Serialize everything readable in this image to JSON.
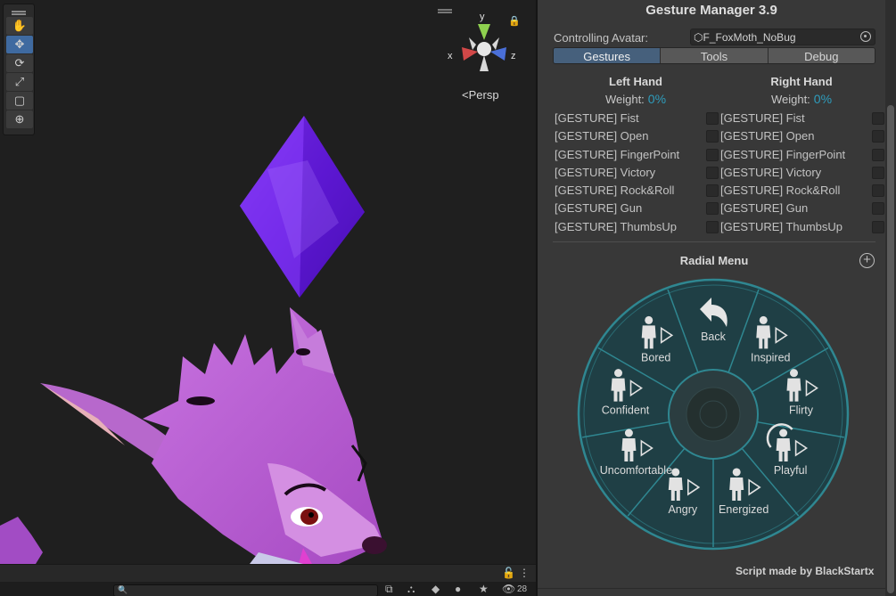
{
  "scene": {
    "view_mode": "Persp",
    "axes": {
      "x": "x",
      "y": "y",
      "z": "z"
    },
    "tools": [
      "hand-icon",
      "move-icon",
      "rotate-icon",
      "scale-icon",
      "rect-icon",
      "transform-icon"
    ],
    "active_tool": 1,
    "bottom_toolbar": {
      "search_icon": "🔍",
      "visibility_count": "28"
    }
  },
  "panel": {
    "title": "Gesture Manager 3.9",
    "avatar_label": "Controlling Avatar:",
    "avatar_value": "F_FoxMoth_NoBug",
    "tabs": [
      {
        "label": "Gestures",
        "active": true
      },
      {
        "label": "Tools",
        "active": false
      },
      {
        "label": "Debug",
        "active": false
      }
    ],
    "left_hand": {
      "title": "Left Hand",
      "weight_label": "Weight:",
      "weight_value": "0%",
      "gestures": [
        "[GESTURE] Fist",
        "[GESTURE] Open",
        "[GESTURE] FingerPoint",
        "[GESTURE] Victory",
        "[GESTURE] Rock&Roll",
        "[GESTURE] Gun",
        "[GESTURE] ThumbsUp"
      ]
    },
    "right_hand": {
      "title": "Right Hand",
      "weight_label": "Weight:",
      "weight_value": "0%",
      "gestures": [
        "[GESTURE] Fist",
        "[GESTURE] Open",
        "[GESTURE] FingerPoint",
        "[GESTURE] Victory",
        "[GESTURE] Rock&Roll",
        "[GESTURE] Gun",
        "[GESTURE] ThumbsUp"
      ]
    },
    "radial_menu_title": "Radial Menu",
    "radial_items": [
      {
        "label": "Back",
        "icon": "back-arrow-icon"
      },
      {
        "label": "Inspired",
        "icon": "person-icon",
        "submenu": true
      },
      {
        "label": "Flirty",
        "icon": "person-icon",
        "submenu": true
      },
      {
        "label": "Playful",
        "icon": "person-rotate-icon",
        "submenu": true
      },
      {
        "label": "Energized",
        "icon": "person-icon",
        "submenu": true
      },
      {
        "label": "Angry",
        "icon": "person-icon",
        "submenu": true
      },
      {
        "label": "Uncomfortable",
        "icon": "person-icon",
        "submenu": true
      },
      {
        "label": "Confident",
        "icon": "person-icon",
        "submenu": true
      },
      {
        "label": "Bored",
        "icon": "person-icon",
        "submenu": true
      }
    ],
    "credit": "Script made by BlackStartx",
    "colors": {
      "accent": "#2e9dbd",
      "tab_active": "#46607c",
      "radial_fill": "#1f3f45",
      "radial_ring": "#2d7b83"
    }
  }
}
